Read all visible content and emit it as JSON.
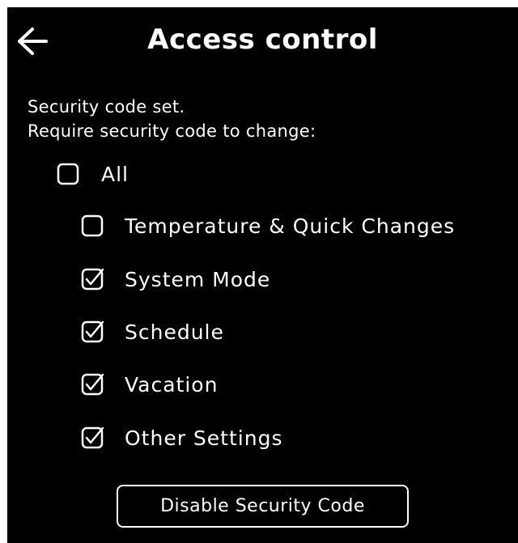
{
  "header": {
    "title": "Access control",
    "back_icon": "arrow-left-icon"
  },
  "intro": {
    "line1": "Security code set.",
    "line2": "Require security code to change:"
  },
  "options": {
    "all": {
      "label": "All",
      "checked": false
    },
    "temperature": {
      "label": "Temperature & Quick Changes",
      "checked": false
    },
    "system_mode": {
      "label": "System Mode",
      "checked": true
    },
    "schedule": {
      "label": "Schedule",
      "checked": true
    },
    "vacation": {
      "label": "Vacation",
      "checked": true
    },
    "other_settings": {
      "label": "Other Settings",
      "checked": true
    }
  },
  "actions": {
    "disable_label": "Disable Security Code"
  },
  "colors": {
    "background": "#000000",
    "foreground": "#ffffff"
  }
}
